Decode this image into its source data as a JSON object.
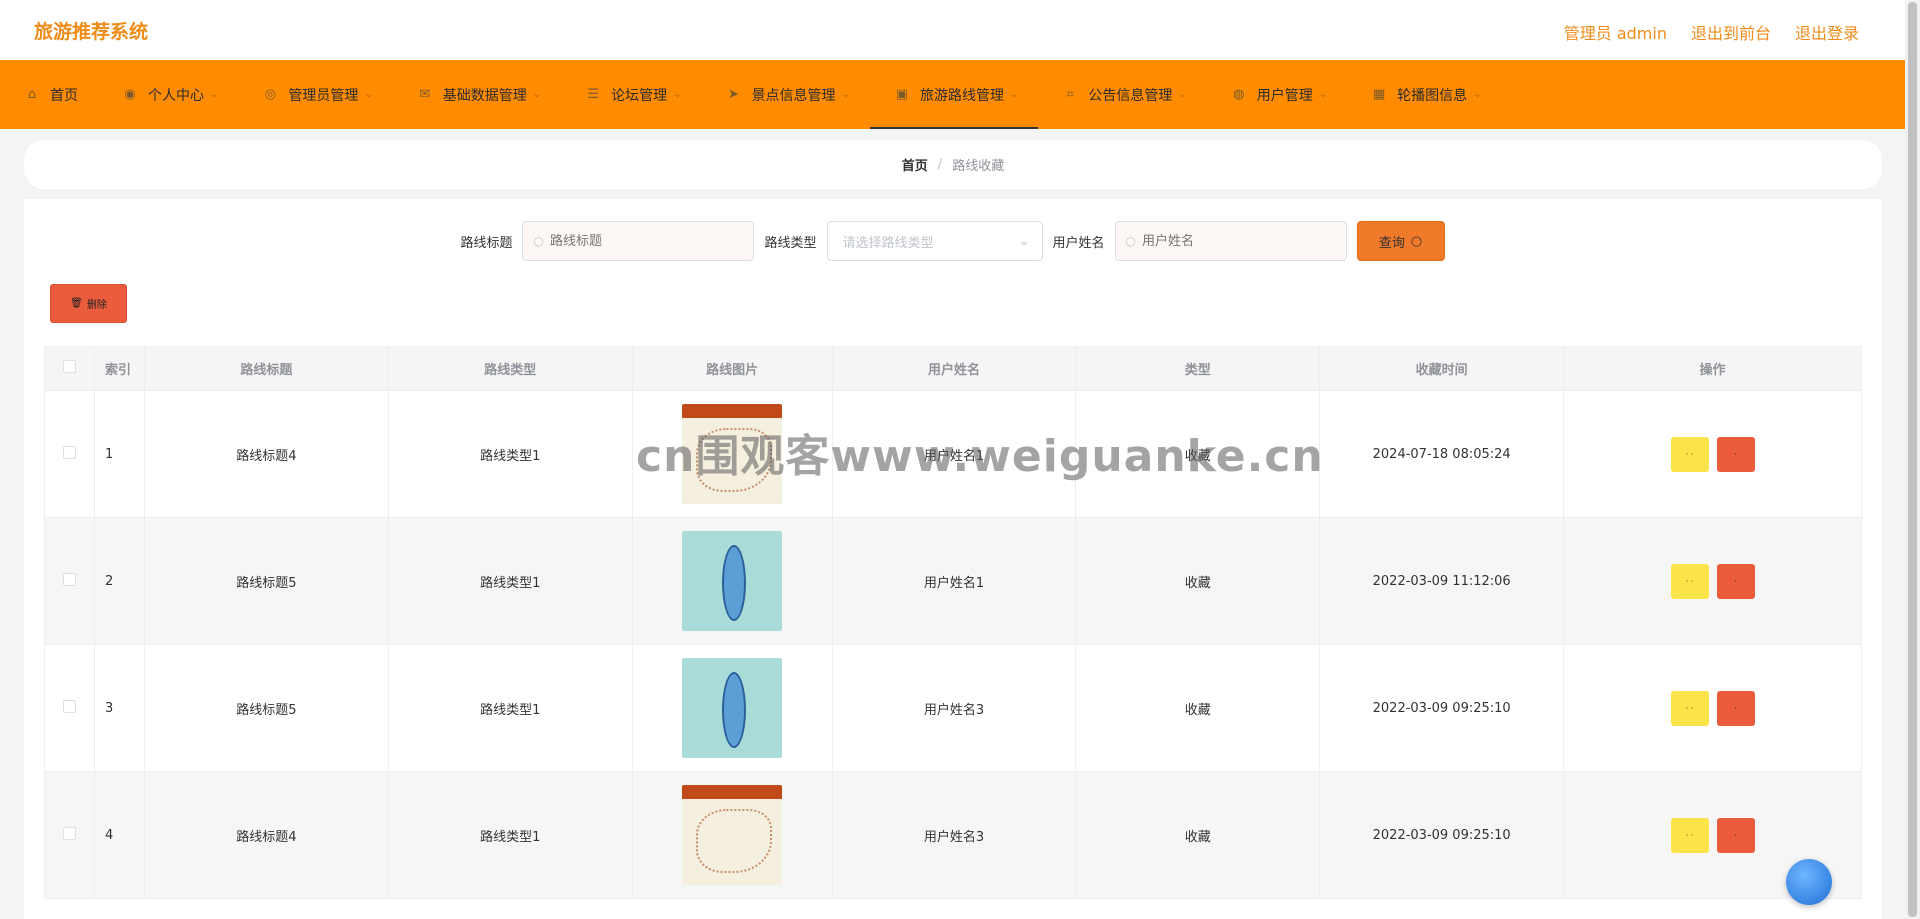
{
  "header": {
    "brand": "旅游推荐系统",
    "links": [
      "管理员 admin",
      "退出到前台",
      "退出登录"
    ]
  },
  "nav": {
    "items": [
      {
        "label": "首页",
        "icon": "home-icon",
        "glyph": "⌂"
      },
      {
        "label": "个人中心",
        "icon": "user-icon",
        "glyph": "◉"
      },
      {
        "label": "管理员管理",
        "icon": "compass-icon",
        "glyph": "◎"
      },
      {
        "label": "基础数据管理",
        "icon": "mail-icon",
        "glyph": "✉"
      },
      {
        "label": "论坛管理",
        "icon": "list-icon",
        "glyph": "☰"
      },
      {
        "label": "景点信息管理",
        "icon": "send-icon",
        "glyph": "➤"
      },
      {
        "label": "旅游路线管理",
        "icon": "bag-icon",
        "glyph": "▣"
      },
      {
        "label": "公告信息管理",
        "icon": "crop-icon",
        "glyph": "⌗"
      },
      {
        "label": "用户管理",
        "icon": "globe-icon",
        "glyph": "◍"
      },
      {
        "label": "轮播图信息",
        "icon": "grid-icon",
        "glyph": "▦"
      }
    ],
    "active_index": 6
  },
  "breadcrumb": {
    "home": "首页",
    "separator": "/",
    "current": "路线收藏"
  },
  "search": {
    "title_label": "路线标题",
    "title_placeholder": "路线标题",
    "type_label": "路线类型",
    "type_placeholder": "请选择路线类型",
    "user_label": "用户姓名",
    "user_placeholder": "用户姓名",
    "query_label": "查询"
  },
  "toolbar": {
    "delete_label": "删除"
  },
  "table": {
    "headers": [
      "索引",
      "路线标题",
      "路线类型",
      "路线图片",
      "用户姓名",
      "类型",
      "收藏时间",
      "操作"
    ],
    "rows": [
      {
        "index": "1",
        "title": "路线标题4",
        "type": "路线类型1",
        "image": "map-a",
        "user": "用户姓名1",
        "kind": "收藏",
        "time": "2024-07-18 08:05:24"
      },
      {
        "index": "2",
        "title": "路线标题5",
        "type": "路线类型1",
        "image": "map-b",
        "user": "用户姓名1",
        "kind": "收藏",
        "time": "2022-03-09 11:12:06"
      },
      {
        "index": "3",
        "title": "路线标题5",
        "type": "路线类型1",
        "image": "map-b",
        "user": "用户姓名3",
        "kind": "收藏",
        "time": "2022-03-09 09:25:10"
      },
      {
        "index": "4",
        "title": "路线标题4",
        "type": "路线类型1",
        "image": "map-a",
        "user": "用户姓名3",
        "kind": "收藏",
        "time": "2022-03-09 09:25:10"
      }
    ]
  },
  "watermark": "cn围观客www.weiguanke.cn",
  "colors": {
    "accent": "#ff8c00",
    "brand": "#f08c1a",
    "danger": "#ea5c3c",
    "warning": "#fbe34a"
  }
}
